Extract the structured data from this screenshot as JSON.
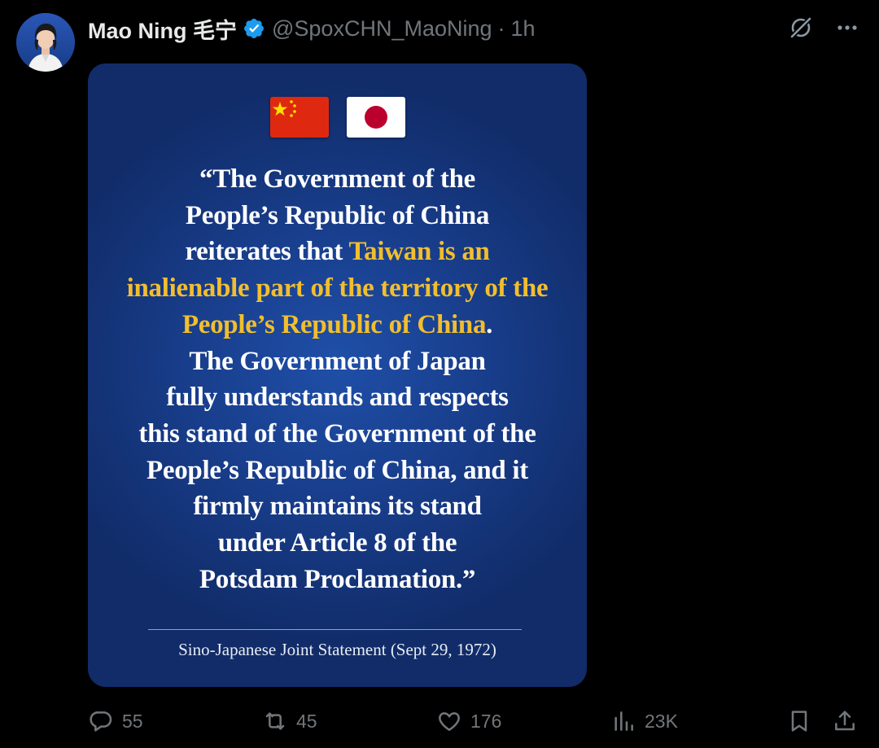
{
  "author": {
    "display_name": "Mao Ning 毛宁",
    "handle": "@SpoxCHN_MaoNing",
    "separator": "·",
    "time": "1h"
  },
  "top_actions": {
    "icons": [
      "grok-icon",
      "more-icon"
    ],
    "more_label": "···"
  },
  "card": {
    "flags": [
      "china-flag",
      "japan-flag"
    ],
    "quote": {
      "line1": "“The Government of the",
      "line2": "People’s Republic of China",
      "line3_prefix": "reiterates that ",
      "line3_highlight": "Taiwan is an",
      "line4_highlight": "inalienable part of the territory of the",
      "line5_highlight": "People’s Republic of China",
      "line5_suffix": ".",
      "line6": "The Government of Japan",
      "line7": "fully understands and respects",
      "line8": "this stand of the Government of the",
      "line9": "People’s Republic of China, and it",
      "line10": "firmly maintains its stand",
      "line11": "under Article 8 of the",
      "line12": "Potsdam Proclamation.”"
    },
    "source": "Sino-Japanese Joint Statement (Sept 29, 1972)",
    "colors": {
      "highlight": "#f2be2e",
      "background": "#1a4192"
    }
  },
  "actions": {
    "replies": "55",
    "reposts": "45",
    "likes": "176",
    "views": "23K"
  },
  "colors": {
    "verified": "#1d9bf0",
    "muted_text": "#71767b",
    "primary_text": "#e7e9ea"
  }
}
